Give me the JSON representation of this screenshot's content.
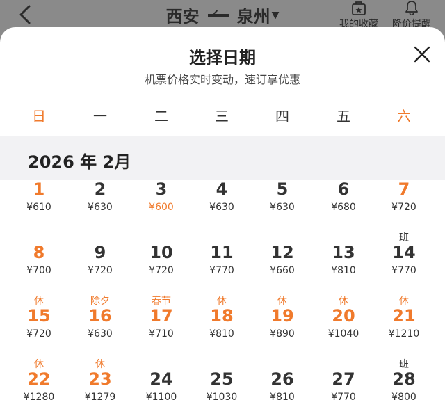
{
  "topbar": {
    "route_from": "西安",
    "route_to": "泉州",
    "favorites_label": "我的收藏",
    "price_alert_label": "降价提醒"
  },
  "sheet": {
    "title": "选择日期",
    "subtitle": "机票价格实时变动，速订享优惠"
  },
  "weekdays": [
    "日",
    "一",
    "二",
    "三",
    "四",
    "五",
    "六"
  ],
  "month_label": "2026 年 2月",
  "colors": {
    "accent": "#f07a2c",
    "text": "#333333",
    "month_bar": "#f2f2f4"
  },
  "weeks": [
    [
      {
        "day": "1",
        "price": "¥610",
        "tag": "",
        "hi": true
      },
      {
        "day": "2",
        "price": "¥630",
        "tag": ""
      },
      {
        "day": "3",
        "price": "¥600",
        "tag": "",
        "low": true
      },
      {
        "day": "4",
        "price": "¥630",
        "tag": ""
      },
      {
        "day": "5",
        "price": "¥630",
        "tag": ""
      },
      {
        "day": "6",
        "price": "¥680",
        "tag": ""
      },
      {
        "day": "7",
        "price": "¥720",
        "tag": "",
        "hi": true
      }
    ],
    [
      {
        "day": "8",
        "price": "¥700",
        "tag": "",
        "hi": true
      },
      {
        "day": "9",
        "price": "¥720",
        "tag": ""
      },
      {
        "day": "10",
        "price": "¥720",
        "tag": ""
      },
      {
        "day": "11",
        "price": "¥770",
        "tag": ""
      },
      {
        "day": "12",
        "price": "¥660",
        "tag": ""
      },
      {
        "day": "13",
        "price": "¥810",
        "tag": ""
      },
      {
        "day": "14",
        "price": "¥770",
        "tag": "班",
        "work": true
      }
    ],
    [
      {
        "day": "15",
        "price": "¥720",
        "tag": "休",
        "hi": true
      },
      {
        "day": "16",
        "price": "¥630",
        "tag": "除夕",
        "hi": true
      },
      {
        "day": "17",
        "price": "¥710",
        "tag": "春节",
        "hi": true
      },
      {
        "day": "18",
        "price": "¥810",
        "tag": "休",
        "hi": true
      },
      {
        "day": "19",
        "price": "¥890",
        "tag": "休",
        "hi": true
      },
      {
        "day": "20",
        "price": "¥1040",
        "tag": "休",
        "hi": true
      },
      {
        "day": "21",
        "price": "¥1210",
        "tag": "休",
        "hi": true
      }
    ],
    [
      {
        "day": "22",
        "price": "¥1280",
        "tag": "休",
        "hi": true
      },
      {
        "day": "23",
        "price": "¥1279",
        "tag": "休",
        "hi": true
      },
      {
        "day": "24",
        "price": "¥1100",
        "tag": ""
      },
      {
        "day": "25",
        "price": "¥1030",
        "tag": ""
      },
      {
        "day": "26",
        "price": "¥810",
        "tag": ""
      },
      {
        "day": "27",
        "price": "¥770",
        "tag": ""
      },
      {
        "day": "28",
        "price": "¥800",
        "tag": "班",
        "work": true
      }
    ]
  ]
}
